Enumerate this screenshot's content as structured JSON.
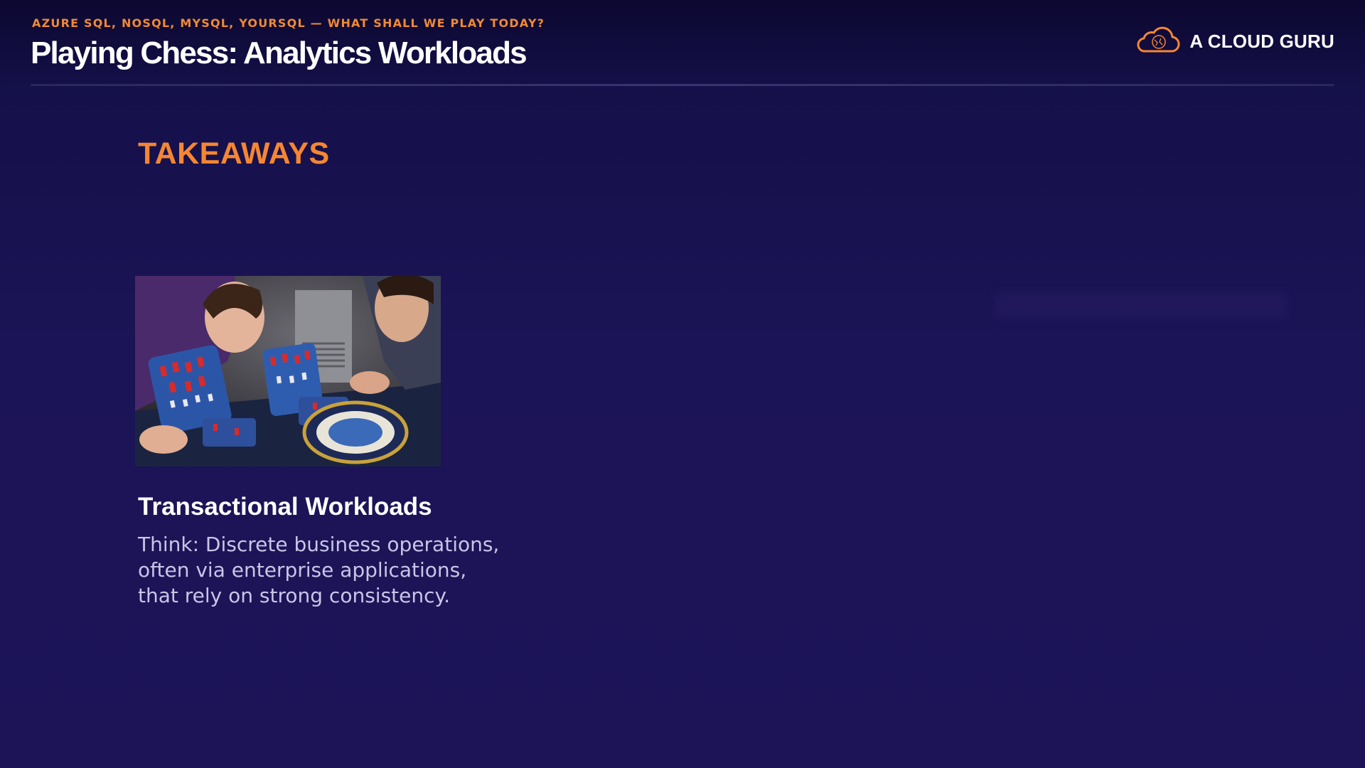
{
  "header": {
    "eyebrow": "AZURE SQL, NOSQL, MYSQL, YOURSQL — WHAT SHALL WE PLAY TODAY?",
    "title": "Playing Chess: Analytics Workloads",
    "logo_text": "A CLOUD GURU",
    "logo_icon": "cloud-icon"
  },
  "main": {
    "section_heading": "TAKEAWAYS",
    "card": {
      "image_alt": "photo-two-people-playing-chess",
      "title": "Transactional Workloads",
      "body_lines": [
        "Think: Discrete business operations,",
        "often via enterprise applications,",
        "that rely on strong consistency."
      ]
    }
  },
  "colors": {
    "accent": "#f58632",
    "background": "#1b1456",
    "title": "#ffffff",
    "body_text": "#c9c5e6"
  }
}
